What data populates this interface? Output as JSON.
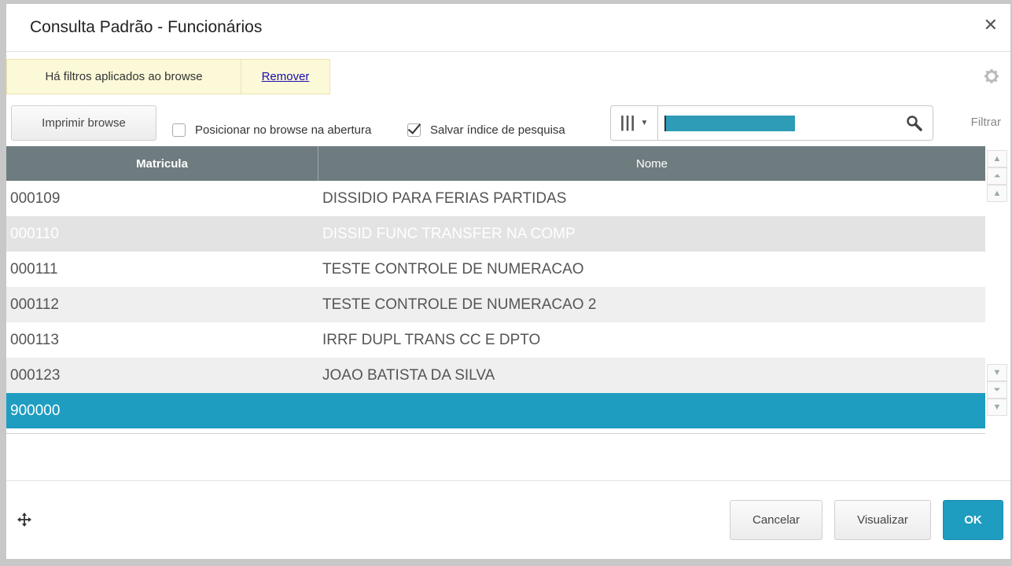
{
  "dialog": {
    "title": "Consulta Padrão - Funcionários",
    "close_symbol": "✕"
  },
  "filter_banner": {
    "text": "Há filtros aplicados ao browse",
    "remove_label": "Remover"
  },
  "toolbar": {
    "print_label": "Imprimir browse",
    "checkbox_position": {
      "label": "Posicionar no browse na abertura",
      "checked": false
    },
    "checkbox_save_index": {
      "label": "Salvar índice de pesquisa",
      "checked": true
    },
    "filter_label": "Filtrar"
  },
  "search": {
    "index_icon": "columns-icon",
    "value": ""
  },
  "grid": {
    "columns": [
      "Matricula",
      "Nome"
    ],
    "rows": [
      {
        "matricula": "000109",
        "nome": "DISSIDIO PARA FERIAS PARTIDAS"
      },
      {
        "matricula": "000110",
        "nome": "DISSID FUNC TRANSFER NA COMP"
      },
      {
        "matricula": "000111",
        "nome": "TESTE CONTROLE DE NUMERACAO"
      },
      {
        "matricula": "000112",
        "nome": "TESTE CONTROLE DE NUMERACAO 2"
      },
      {
        "matricula": "000113",
        "nome": "IRRF DUPL TRANS CC E DPTO"
      },
      {
        "matricula": "000123",
        "nome": "JOAO BATISTA DA SILVA"
      },
      {
        "matricula": "900000",
        "nome": ""
      }
    ],
    "selected_index": 6
  },
  "footer": {
    "cancel_label": "Cancelar",
    "view_label": "Visualizar",
    "ok_label": "OK"
  },
  "colors": {
    "accent": "#1e9dc1",
    "header": "#6e7b7f",
    "banner": "#fcf9d9"
  }
}
